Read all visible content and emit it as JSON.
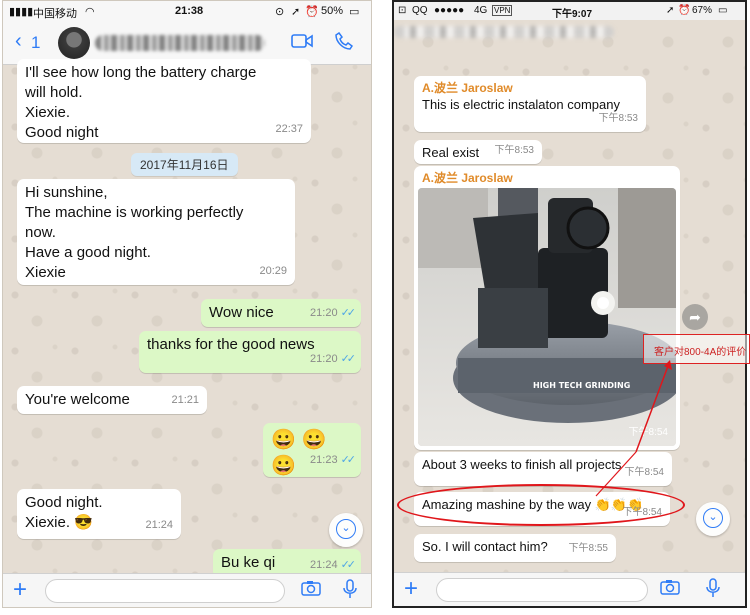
{
  "left": {
    "status": {
      "carrier": "中国移动",
      "time": "21:38",
      "battery": "50%"
    },
    "nav": {
      "back_count": "1"
    },
    "messages": [
      {
        "dir": "in",
        "text": "I'll see how long the battery charge\nwill hold.\nXiexie.\nGood night",
        "time": "22:37"
      },
      {
        "dir": "date",
        "text": "2017年11月16日"
      },
      {
        "dir": "in",
        "text": "Hi sunshine,\nThe machine is working perfectly\nnow.\nHave a good night.\nXiexie",
        "time": "20:29"
      },
      {
        "dir": "out",
        "text": "Wow nice",
        "time": "21:20"
      },
      {
        "dir": "out",
        "text": "thanks for the good news",
        "time": "21:20"
      },
      {
        "dir": "in",
        "text": "You're welcome",
        "time": "21:21"
      },
      {
        "dir": "out",
        "text": "😀 😀 😀",
        "time": "21:23"
      },
      {
        "dir": "in",
        "text": "Good night.\nXiexie. 😎",
        "time": "21:24"
      },
      {
        "dir": "out",
        "text": "Bu ke qi",
        "time": "21:24"
      }
    ]
  },
  "right": {
    "status": {
      "carrier": "QQ",
      "network": "4G",
      "vpn": "VPN",
      "time": "下午9:07",
      "battery": "67%"
    },
    "messages": [
      {
        "dir": "in",
        "sender": "A.波兰 Jaroslaw",
        "text": "This is electric instalaton company",
        "time": "下午8:53"
      },
      {
        "dir": "in",
        "text": "Real exist",
        "time": "下午8:53"
      },
      {
        "dir": "in",
        "sender": "A.波兰 Jaroslaw",
        "type": "photo",
        "time": "下午8:54"
      },
      {
        "dir": "in",
        "text": "About 3 weeks to finish all projects",
        "time": "下午8:54"
      },
      {
        "dir": "in",
        "text": "Amazing mashine by the way 👏👏👏",
        "time": "下午8:54"
      },
      {
        "dir": "in",
        "text": "So. I will contact him?",
        "time": "下午8:55"
      }
    ],
    "annotation": "客户对800-4A的评价",
    "photo_brand": "HIGH TECH GRINDING"
  },
  "colors": {
    "accent": "#2f7cf6",
    "outgoing": "#dcf8c6",
    "incoming": "#ffffff",
    "annotation": "#e0161b",
    "sender": "#e08b2a"
  }
}
